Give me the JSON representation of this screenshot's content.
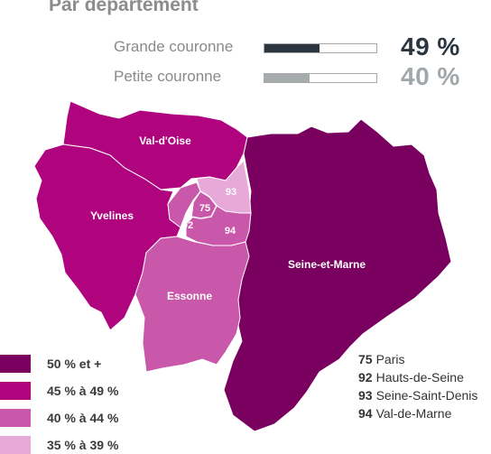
{
  "title": "Par département",
  "comparison": [
    {
      "label": "Grande couronne",
      "value_text": "49 %",
      "fraction": 0.49,
      "color": "#2b3640",
      "text_color": "#2b3640"
    },
    {
      "label": "Petite couronne",
      "value_text": "40 %",
      "fraction": 0.4,
      "color": "#a6abae",
      "text_color": "#a2a7ab"
    }
  ],
  "departments": {
    "val_doise": {
      "label": "Val-d'Oise",
      "color": "#b0047f"
    },
    "yvelines": {
      "label": "Yvelines",
      "color": "#b0047f"
    },
    "seine_et_marne": {
      "label": "Seine-et-Marne",
      "color": "#7a005f"
    },
    "essonne": {
      "label": "Essonne",
      "color": "#ca58aa"
    },
    "paris": {
      "label": "75",
      "color": "#ca58aa"
    },
    "hauts_de_seine": {
      "label": "92",
      "color": "#ca58aa"
    },
    "seine_saint_denis": {
      "label": "93",
      "color": "#e7a9d8"
    },
    "val_de_marne": {
      "label": "94",
      "color": "#ca58aa"
    }
  },
  "legend": [
    {
      "label": "50 % et +",
      "color": "#7a005f"
    },
    {
      "label": "45 % à 49 %",
      "color": "#b0047f"
    },
    {
      "label": "40 % à 44 %",
      "color": "#ca58aa"
    },
    {
      "label": "35 % à 39 %",
      "color": "#e7a9d8"
    }
  ],
  "codes": [
    {
      "code": "75",
      "name": "Paris"
    },
    {
      "code": "92",
      "name": "Hauts-de-Seine"
    },
    {
      "code": "93",
      "name": "Seine-Saint-Denis"
    },
    {
      "code": "94",
      "name": "Val-de-Marne"
    }
  ]
}
